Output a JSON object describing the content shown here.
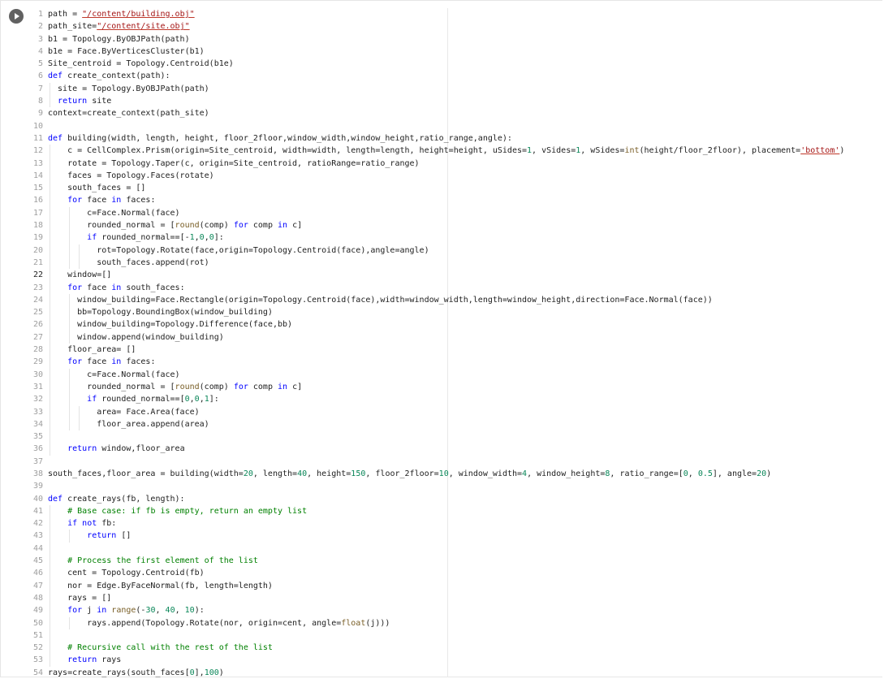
{
  "cell": {
    "run_icon": "play-circle-icon",
    "active_line": 22
  },
  "colors": {
    "string": "#a31515",
    "keyword": "#0000ff",
    "number": "#098658",
    "comment": "#008000",
    "builtin": "#795e26",
    "line_number": "#9e9e9e"
  },
  "lines": [
    {
      "n": "1",
      "indent": 0,
      "code": "path = \"/content/building.obj\""
    },
    {
      "n": "2",
      "indent": 0,
      "code": "path_site=\"/content/site.obj\""
    },
    {
      "n": "3",
      "indent": 0,
      "code": "b1 = Topology.ByOBJPath(path)"
    },
    {
      "n": "4",
      "indent": 0,
      "code": "b1e = Face.ByVerticesCluster(b1)"
    },
    {
      "n": "5",
      "indent": 0,
      "code": "Site_centroid = Topology.Centroid(b1e)"
    },
    {
      "n": "6",
      "indent": 0,
      "code": "def create_context(path):"
    },
    {
      "n": "7",
      "indent": 1,
      "code": "  site = Topology.ByOBJPath(path)"
    },
    {
      "n": "8",
      "indent": 1,
      "code": "  return site"
    },
    {
      "n": "9",
      "indent": 0,
      "code": "context=create_context(path_site)"
    },
    {
      "n": "10",
      "indent": 0,
      "code": ""
    },
    {
      "n": "11",
      "indent": 0,
      "code": "def building(width, length, height, floor_2floor,window_width,window_height,ratio_range,angle):"
    },
    {
      "n": "12",
      "indent": 1,
      "code": "    c = CellComplex.Prism(origin=Site_centroid, width=width, length=length, height=height, uSides=1, vSides=1, wSides=int(height/floor_2floor), placement='bottom')"
    },
    {
      "n": "13",
      "indent": 1,
      "code": "    rotate = Topology.Taper(c, origin=Site_centroid, ratioRange=ratio_range)"
    },
    {
      "n": "14",
      "indent": 1,
      "code": "    faces = Topology.Faces(rotate)"
    },
    {
      "n": "15",
      "indent": 1,
      "code": "    south_faces = []"
    },
    {
      "n": "16",
      "indent": 1,
      "code": "    for face in faces:"
    },
    {
      "n": "17",
      "indent": 2,
      "code": "        c=Face.Normal(face)"
    },
    {
      "n": "18",
      "indent": 2,
      "code": "        rounded_normal = [round(comp) for comp in c]"
    },
    {
      "n": "19",
      "indent": 2,
      "code": "        if rounded_normal==[-1,0,0]:"
    },
    {
      "n": "20",
      "indent": 3,
      "code": "          rot=Topology.Rotate(face,origin=Topology.Centroid(face),angle=angle)"
    },
    {
      "n": "21",
      "indent": 3,
      "code": "          south_faces.append(rot)"
    },
    {
      "n": "22",
      "indent": 1,
      "code": "    window=[]"
    },
    {
      "n": "23",
      "indent": 1,
      "code": "    for face in south_faces:"
    },
    {
      "n": "24",
      "indent": 2,
      "code": "      window_building=Face.Rectangle(origin=Topology.Centroid(face),width=window_width,length=window_height,direction=Face.Normal(face))"
    },
    {
      "n": "25",
      "indent": 2,
      "code": "      bb=Topology.BoundingBox(window_building)"
    },
    {
      "n": "26",
      "indent": 2,
      "code": "      window_building=Topology.Difference(face,bb)"
    },
    {
      "n": "27",
      "indent": 2,
      "code": "      window.append(window_building)"
    },
    {
      "n": "28",
      "indent": 1,
      "code": "    floor_area= []"
    },
    {
      "n": "29",
      "indent": 1,
      "code": "    for face in faces:"
    },
    {
      "n": "30",
      "indent": 2,
      "code": "        c=Face.Normal(face)"
    },
    {
      "n": "31",
      "indent": 2,
      "code": "        rounded_normal = [round(comp) for comp in c]"
    },
    {
      "n": "32",
      "indent": 2,
      "code": "        if rounded_normal==[0,0,1]:"
    },
    {
      "n": "33",
      "indent": 3,
      "code": "          area= Face.Area(face)"
    },
    {
      "n": "34",
      "indent": 3,
      "code": "          floor_area.append(area)"
    },
    {
      "n": "35",
      "indent": 1,
      "code": ""
    },
    {
      "n": "36",
      "indent": 1,
      "code": "    return window,floor_area"
    },
    {
      "n": "37",
      "indent": 0,
      "code": ""
    },
    {
      "n": "38",
      "indent": 0,
      "code": "south_faces,floor_area = building(width=20, length=40, height=150, floor_2floor=10, window_width=4, window_height=8, ratio_range=[0, 0.5], angle=20)"
    },
    {
      "n": "39",
      "indent": 0,
      "code": ""
    },
    {
      "n": "40",
      "indent": 0,
      "code": "def create_rays(fb, length):"
    },
    {
      "n": "41",
      "indent": 1,
      "code": "    # Base case: if fb is empty, return an empty list"
    },
    {
      "n": "42",
      "indent": 1,
      "code": "    if not fb:"
    },
    {
      "n": "43",
      "indent": 2,
      "code": "        return []"
    },
    {
      "n": "44",
      "indent": 1,
      "code": ""
    },
    {
      "n": "45",
      "indent": 1,
      "code": "    # Process the first element of the list"
    },
    {
      "n": "46",
      "indent": 1,
      "code": "    cent = Topology.Centroid(fb)"
    },
    {
      "n": "47",
      "indent": 1,
      "code": "    nor = Edge.ByFaceNormal(fb, length=length)"
    },
    {
      "n": "48",
      "indent": 1,
      "code": "    rays = []"
    },
    {
      "n": "49",
      "indent": 1,
      "code": "    for j in range(-30, 40, 10):"
    },
    {
      "n": "50",
      "indent": 2,
      "code": "        rays.append(Topology.Rotate(nor, origin=cent, angle=float(j)))"
    },
    {
      "n": "51",
      "indent": 1,
      "code": ""
    },
    {
      "n": "52",
      "indent": 1,
      "code": "    # Recursive call with the rest of the list"
    },
    {
      "n": "53",
      "indent": 1,
      "code": "    return rays"
    },
    {
      "n": "54",
      "indent": 0,
      "code": "rays=create_rays(south_faces[0],100)"
    }
  ]
}
